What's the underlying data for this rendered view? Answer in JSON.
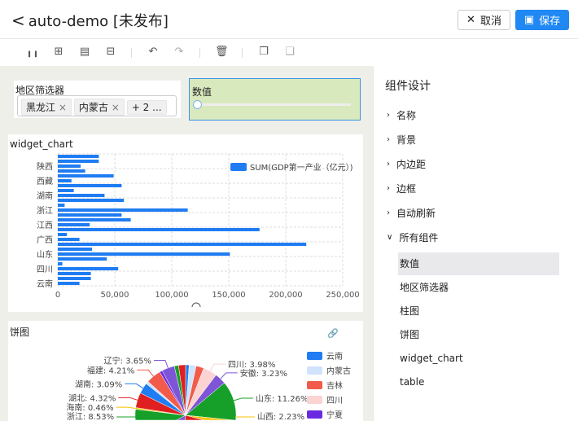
{
  "header": {
    "title": "auto-demo [未发布]",
    "cancel": "取消",
    "save": "保存"
  },
  "toolbar": {
    "icons": [
      "bar-chart-icon",
      "add-component-icon",
      "layout-icon",
      "settings-sliders-icon",
      "undo-icon",
      "redo-icon",
      "delete-icon",
      "copy-icon",
      "paste-icon"
    ]
  },
  "filter": {
    "title": "地区筛选器",
    "tags": [
      "黑龙江",
      "内蒙古"
    ],
    "more": "+ 2 ..."
  },
  "slider": {
    "title": "数值",
    "value": 0
  },
  "bar_widget": {
    "title": "widget_chart"
  },
  "pie_widget": {
    "title": "饼图"
  },
  "panel": {
    "title": "组件设计",
    "sections": [
      "名称",
      "背景",
      "内边距",
      "边框",
      "自动刷新",
      "所有组件"
    ],
    "components": [
      "数值",
      "地区筛选器",
      "柱图",
      "饼图",
      "widget_chart",
      "table"
    ]
  },
  "chart_data": [
    {
      "type": "bar",
      "orientation": "horizontal",
      "title": "widget_chart",
      "legend": "SUM(GDP第一产业（亿元）)",
      "legend_position": "top-right",
      "xlim": [
        0,
        250000
      ],
      "xticks": [
        "0",
        "50,000",
        "100,000",
        "150,000",
        "200,000",
        "250,000"
      ],
      "categories": [
        "云南",
        "",
        "",
        "四川",
        "",
        "",
        "山东",
        "",
        "",
        "广西",
        "",
        "",
        "江西",
        "",
        "",
        "浙江",
        "",
        "",
        "湖南",
        "",
        "",
        "西藏",
        "",
        "",
        "陕西",
        "",
        ""
      ],
      "values": [
        19000,
        29000,
        29000,
        53000,
        4000,
        43000,
        151000,
        30000,
        218000,
        19000,
        8000,
        177000,
        28000,
        64000,
        56000,
        114000,
        6000,
        58000,
        41000,
        14000,
        56000,
        12000,
        49000,
        24000,
        20000,
        36000,
        36000
      ],
      "color": "#1f7cf2"
    },
    {
      "type": "pie",
      "title": "饼图",
      "legend": [
        {
          "name": "云南",
          "color": "#1f7cf2"
        },
        {
          "name": "内蒙古",
          "color": "#cfe3fb"
        },
        {
          "name": "吉林",
          "color": "#f25a4a"
        },
        {
          "name": "四川",
          "color": "#fbd3d3"
        },
        {
          "name": "宁夏",
          "color": "#6a2be0"
        }
      ],
      "slices": [
        {
          "name": "云南",
          "value": 1.0,
          "color": "#1f7cf2"
        },
        {
          "name": "内蒙古",
          "value": 2.0,
          "color": "#cfe3fb"
        },
        {
          "name": "吉林",
          "value": 2.2,
          "color": "#f25a4a"
        },
        {
          "name": "四川",
          "value": 3.98,
          "color": "#fbd3d3",
          "label": "四川: 3.98%"
        },
        {
          "name": "安徽",
          "value": 3.23,
          "color": "#7d55d6",
          "label": "安徽: 3.23%"
        },
        {
          "name": "山东",
          "value": 11.26,
          "color": "#16a02a",
          "label": "山东: 11.26%"
        },
        {
          "name": "山西",
          "value": 2.23,
          "color": "#f5c400",
          "label": "山西: 2.23%"
        },
        {
          "name": "",
          "value": 20,
          "color": "#e02020"
        },
        {
          "name": "",
          "value": 14,
          "color": "#7d55d6"
        },
        {
          "name": "浙江",
          "value": 8.53,
          "color": "#16a02a",
          "label": "浙江: 8.53%"
        },
        {
          "name": "海南",
          "value": 0.46,
          "color": "#f5c400",
          "label": "海南: 0.46%"
        },
        {
          "name": "湖北",
          "value": 4.32,
          "color": "#e02020",
          "label": "湖北: 4.32%"
        },
        {
          "name": "湖南",
          "value": 3.09,
          "color": "#1f7cf2",
          "label": "湖南: 3.09%"
        },
        {
          "name": "",
          "value": 0.8,
          "color": "#cfe3fb"
        },
        {
          "name": "福建",
          "value": 4.21,
          "color": "#f25a4a",
          "label": "福建: 4.21%"
        },
        {
          "name": "",
          "value": 0.8,
          "color": "#6a2be0"
        },
        {
          "name": "辽宁",
          "value": 3.65,
          "color": "#7d55d6",
          "label": "辽宁: 3.65%"
        },
        {
          "name": "",
          "value": 1.2,
          "color": "#16a02a"
        },
        {
          "name": "",
          "value": 2.0,
          "color": "#e02020"
        }
      ]
    }
  ]
}
